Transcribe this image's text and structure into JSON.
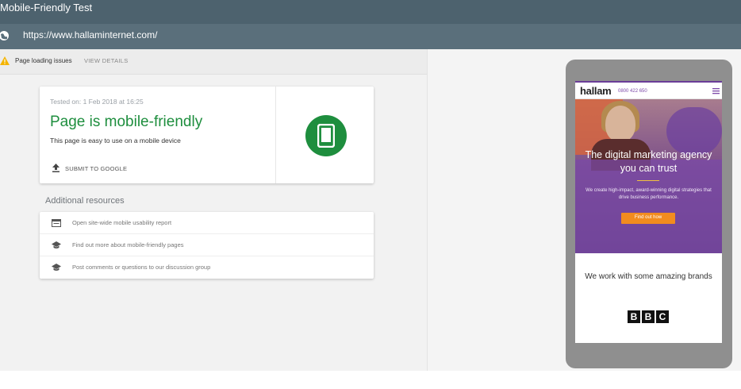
{
  "app": {
    "title": "Mobile-Friendly Test"
  },
  "url_bar": {
    "url": "https://www.hallaminternet.com/",
    "icon": "globe-icon"
  },
  "issues_bar": {
    "text": "Page loading issues",
    "action": "VIEW DETAILS",
    "icon": "warning-icon",
    "icon_color": "#f4b400"
  },
  "result": {
    "tested_on": "Tested on: 1 Feb 2018 at 16:25",
    "verdict": "Page is mobile-friendly",
    "description": "This page is easy to use on a mobile device",
    "submit_label": "SUBMIT TO GOOGLE",
    "submit_icon": "upload-icon",
    "badge_icon": "smartphone-icon",
    "accent_color": "#1e8e3e"
  },
  "resources": {
    "title": "Additional resources",
    "items": [
      {
        "label": "Open site-wide mobile usability report",
        "icon": "report-icon"
      },
      {
        "label": "Find out more about mobile-friendly pages",
        "icon": "school-icon"
      },
      {
        "label": "Post comments or questions to our discussion group",
        "icon": "school-icon"
      }
    ]
  },
  "preview": {
    "brand": "hallam",
    "phone": "0800 422 650",
    "hero_title": "The digital marketing agency you can trust",
    "hero_sub": "We create high-impact, award-winning digital strategies that drive business performance.",
    "cta": "Find out how",
    "brands_text": "We work with some amazing brands",
    "brand_logo": [
      "B",
      "B",
      "C"
    ],
    "accent_color": "#7a4aa8",
    "cta_color": "#f28c1e"
  }
}
